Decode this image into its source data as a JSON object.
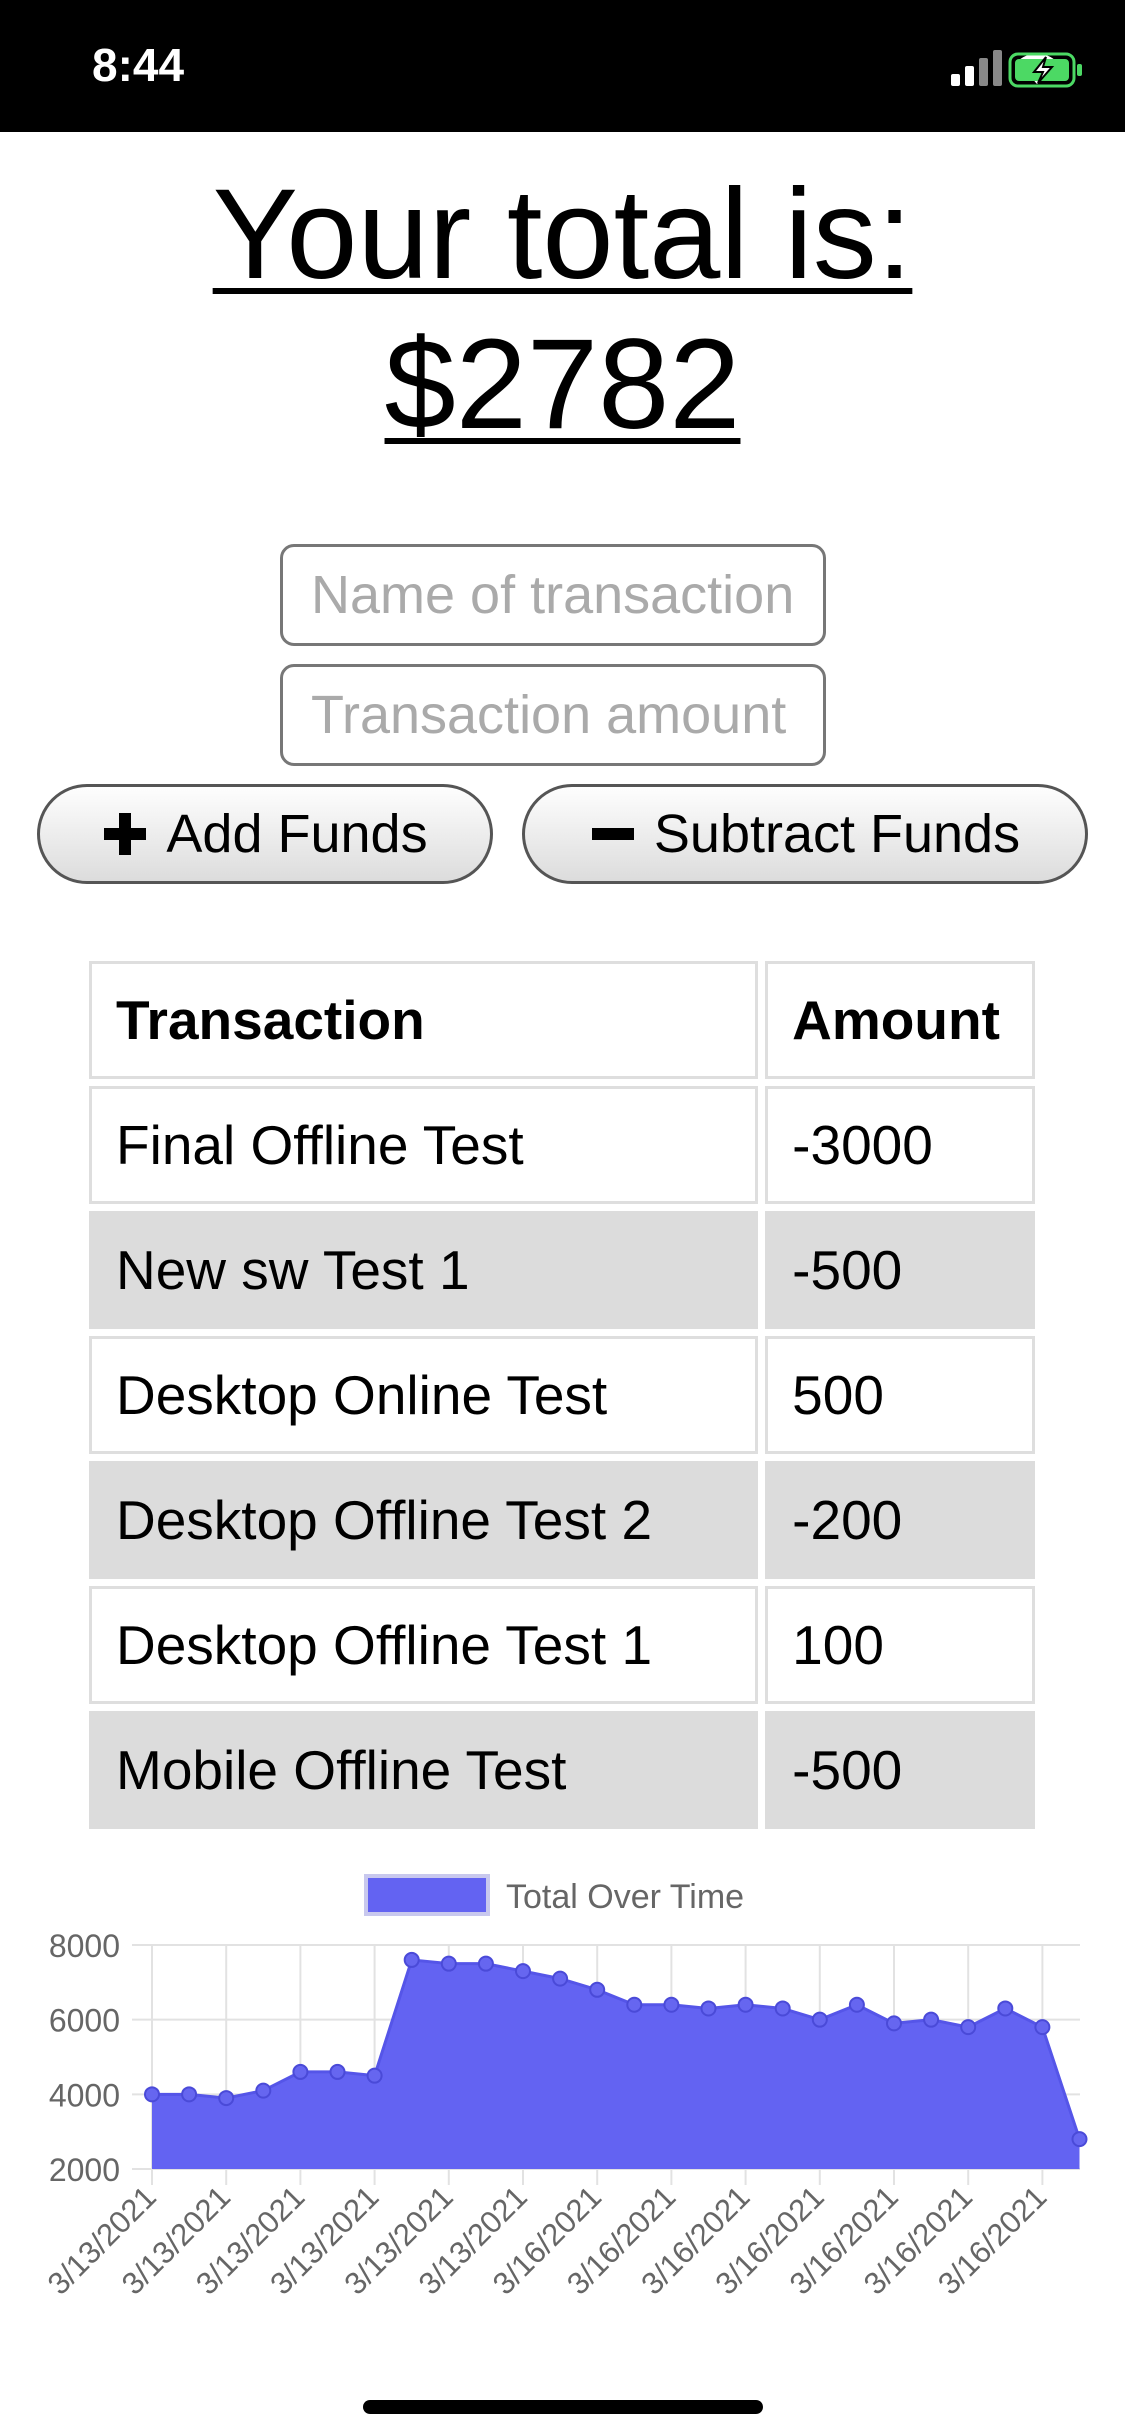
{
  "status_bar": {
    "time": "8:44"
  },
  "header": {
    "title_line1": "Your total is:",
    "title_line2": "$2782"
  },
  "form": {
    "name_placeholder": "Name of transaction",
    "amount_placeholder": "Transaction amount",
    "add_label": "Add Funds",
    "subtract_label": "Subtract Funds"
  },
  "table": {
    "headers": [
      "Transaction",
      "Amount"
    ],
    "rows": [
      {
        "name": "Final Offline Test",
        "amount": "-3000"
      },
      {
        "name": "New sw Test 1",
        "amount": "-500"
      },
      {
        "name": "Desktop Online Test",
        "amount": "500"
      },
      {
        "name": "Desktop Offline Test 2",
        "amount": "-200"
      },
      {
        "name": "Desktop Offline Test 1",
        "amount": "100"
      },
      {
        "name": "Mobile Offline Test",
        "amount": "-500"
      }
    ]
  },
  "chart_data": {
    "type": "area",
    "legend": "Total Over Time",
    "color": "#6363f2",
    "ylim": [
      2000,
      8000
    ],
    "yticks": [
      2000,
      4000,
      6000,
      8000
    ],
    "x": [
      "3/13/2021",
      "3/13/2021",
      "3/13/2021",
      "3/13/2021",
      "3/13/2021",
      "3/13/2021",
      "3/13/2021",
      "3/13/2021",
      "3/13/2021",
      "3/13/2021",
      "3/13/2021",
      "3/16/2021",
      "3/16/2021",
      "3/16/2021",
      "3/16/2021",
      "3/16/2021",
      "3/16/2021",
      "3/16/2021",
      "3/16/2021",
      "3/16/2021",
      "3/16/2021",
      "3/16/2021",
      "3/16/2021",
      "3/16/2021",
      "3/16/2021",
      "3/16/2021",
      "3/16/2021"
    ],
    "xtick_labels": [
      "3/13/2021",
      "3/13/2021",
      "3/13/2021",
      "3/13/2021",
      "3/13/2021",
      "3/13/2021",
      "3/16/2021",
      "3/16/2021",
      "3/16/2021",
      "3/16/2021",
      "3/16/2021",
      "3/16/2021",
      "3/16/2021"
    ],
    "values": [
      4000,
      4000,
      3900,
      4100,
      4600,
      4600,
      4500,
      7600,
      7500,
      7500,
      7300,
      7100,
      6800,
      6400,
      6400,
      6300,
      6400,
      6300,
      6000,
      6400,
      5900,
      6000,
      5800,
      6300,
      5800,
      2800
    ]
  }
}
